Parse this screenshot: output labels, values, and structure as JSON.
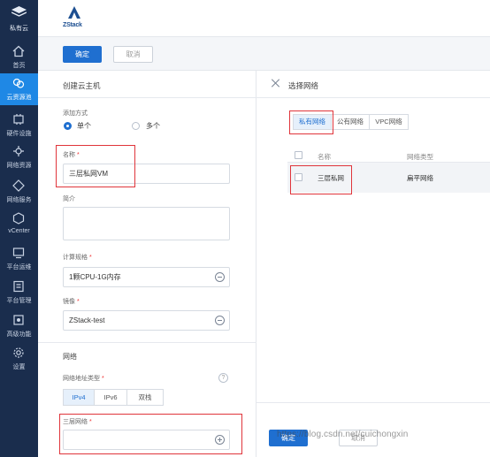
{
  "sidebar": {
    "brand_label": "私有云",
    "items": [
      {
        "label": "首页",
        "icon": "home-icon"
      },
      {
        "label": "云资源池",
        "icon": "cloud-resource-icon",
        "active": true
      },
      {
        "label": "硬件设施",
        "icon": "hardware-icon"
      },
      {
        "label": "网络资源",
        "icon": "network-resource-icon"
      },
      {
        "label": "网络服务",
        "icon": "network-service-icon"
      },
      {
        "label": "vCenter",
        "icon": "vcenter-icon"
      },
      {
        "label": "平台运维",
        "icon": "platform-ops-icon"
      },
      {
        "label": "平台管理",
        "icon": "platform-manage-icon"
      },
      {
        "label": "高级功能",
        "icon": "advanced-icon"
      },
      {
        "label": "设置",
        "icon": "settings-icon"
      }
    ]
  },
  "header": {
    "logo_text": "ZStack"
  },
  "toolbar": {
    "confirm_label": "确定",
    "cancel_label": "取消"
  },
  "left_panel": {
    "title": "创建云主机",
    "add_mode": {
      "label": "添加方式",
      "options": [
        "单个",
        "多个"
      ],
      "selected": "单个"
    },
    "name": {
      "label": "名称",
      "required_mark": "*",
      "value": "三层私网VM"
    },
    "description": {
      "label": "简介",
      "value": ""
    },
    "compute": {
      "label": "计算规格",
      "required_mark": "*",
      "value": "1颗CPU-1G内存"
    },
    "image": {
      "label": "镜像",
      "required_mark": "*",
      "value": "ZStack-test"
    },
    "network_section": "网络",
    "address_type": {
      "label": "网络地址类型",
      "required_mark": "*",
      "options": [
        "IPv4",
        "IPv6",
        "双栈"
      ],
      "selected": "IPv4",
      "help": "?"
    },
    "l3_network": {
      "label": "三层网络",
      "required_mark": "*",
      "value": ""
    }
  },
  "right_panel": {
    "title": "选择网络",
    "tabs": [
      "私有网络",
      "公有网络",
      "VPC网络"
    ],
    "active_tab": "私有网络",
    "columns": [
      "名称",
      "网络类型"
    ],
    "rows": [
      {
        "name": "三层私网",
        "type": "扁平网络"
      }
    ],
    "confirm_label": "确定",
    "cancel_label": "取消"
  },
  "watermark": "https://blog.csdn.net/cuichongxin",
  "colors": {
    "sidebar": "#1a2d4d",
    "active": "#1f88e5",
    "primary": "#1f6fd0",
    "highlight": "#e0353b"
  }
}
